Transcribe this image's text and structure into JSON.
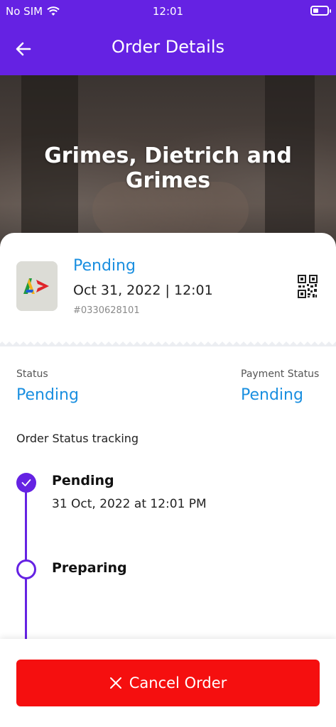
{
  "status_bar": {
    "carrier": "No SIM",
    "time": "12:01"
  },
  "header": {
    "title": "Order Details"
  },
  "hero": {
    "restaurant_name": "Grimes, Dietrich and Grimes"
  },
  "order": {
    "status": "Pending",
    "date_time": "Oct 31, 2022 | 12:01",
    "number": "#0330628101"
  },
  "summary": {
    "status_label": "Status",
    "status_value": "Pending",
    "payment_label": "Payment Status",
    "payment_value": "Pending"
  },
  "tracking": {
    "title": "Order Status tracking",
    "steps": [
      {
        "title": "Pending",
        "time": "31 Oct, 2022 at 12:01 PM",
        "done": true
      },
      {
        "title": "Preparing",
        "done": false
      }
    ]
  },
  "actions": {
    "cancel_label": "Cancel Order"
  },
  "colors": {
    "primary": "#6522e3",
    "accent_blue": "#1a8fe0",
    "danger": "#f50f0f"
  },
  "icons": [
    "wifi-icon",
    "battery-icon",
    "back-arrow-icon",
    "qr-code-icon",
    "check-icon",
    "close-icon"
  ]
}
